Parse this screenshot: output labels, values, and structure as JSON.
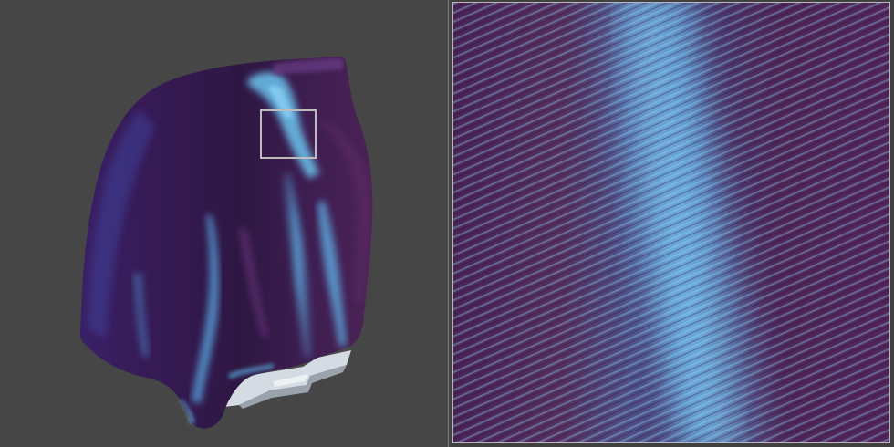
{
  "viewport": {
    "background_color": "#464646",
    "cloth_base_color": "#3e1f4e",
    "cloth_sheen_color": "#5ab6ea",
    "platform_color": "#d7dde3",
    "selection_outline_color": "#bdbdbd"
  },
  "zoom_panel": {
    "base_color": "#4e2557",
    "highlight_color": "#6ab8ee",
    "frame_color": "#b9b9b9"
  }
}
